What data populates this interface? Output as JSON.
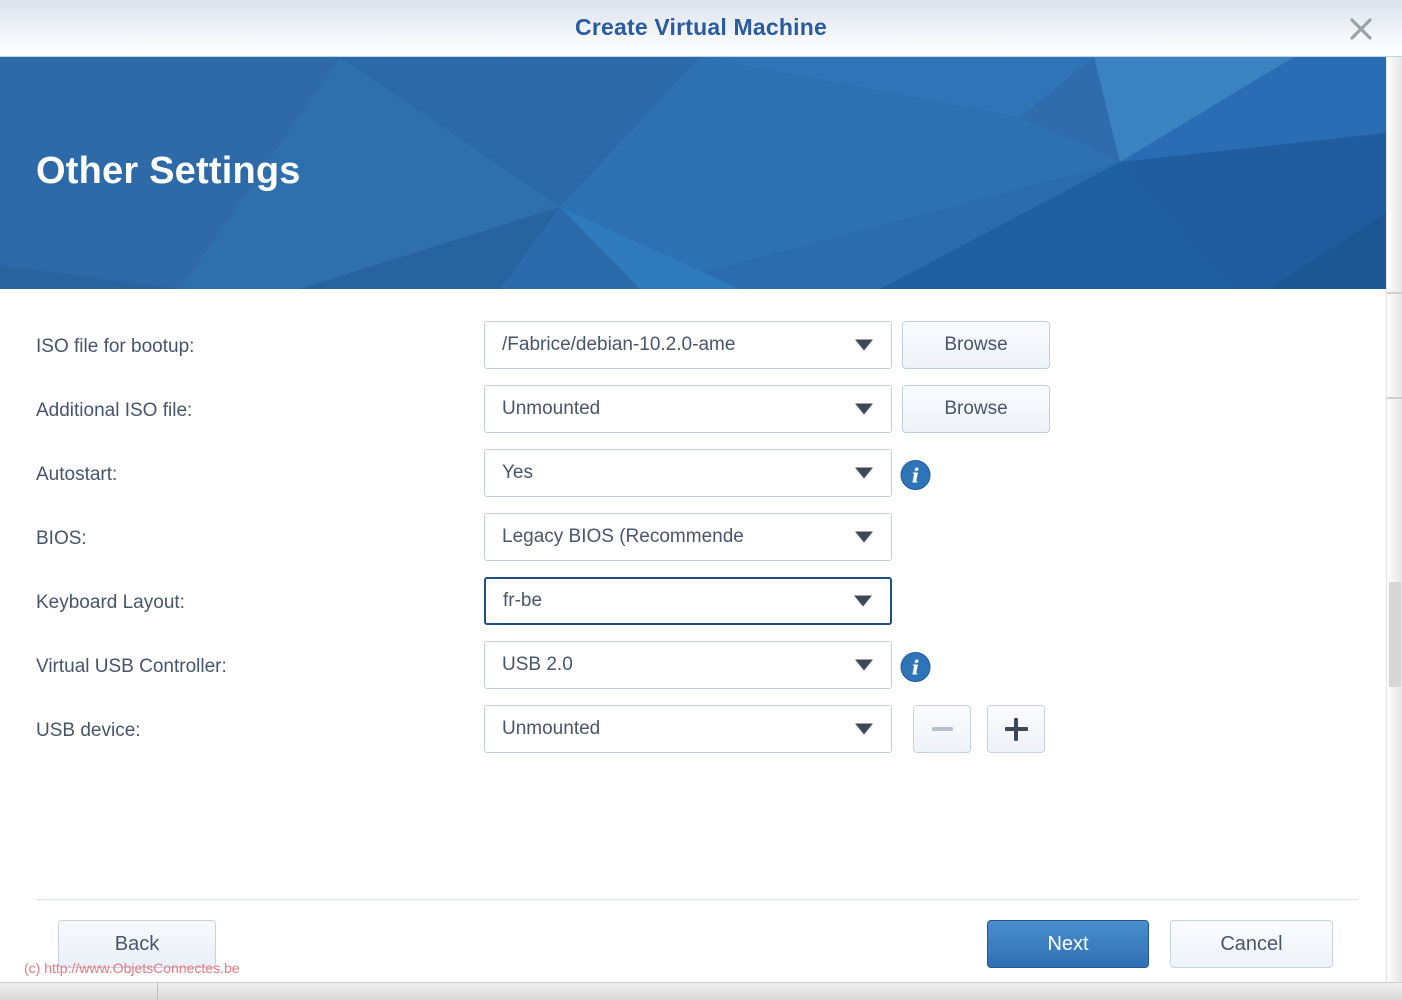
{
  "window": {
    "title": "Create Virtual Machine",
    "close_icon": "close-icon"
  },
  "banner": {
    "heading": "Other Settings",
    "accent_color": "#2e6cab"
  },
  "form": {
    "rows": [
      {
        "label": "ISO file for bootup:",
        "value": "/Fabrice/debian-10.2.0-amе",
        "control": "select",
        "action": "Browse",
        "name": "iso-file-for-bootup",
        "focused": false,
        "info": false
      },
      {
        "label": "Additional ISO file:",
        "value": "Unmounted",
        "control": "select",
        "action": "Browse",
        "name": "additional-iso-file",
        "focused": false,
        "info": false
      },
      {
        "label": "Autostart:",
        "value": "Yes",
        "control": "select",
        "name": "autostart",
        "focused": false,
        "info": true
      },
      {
        "label": "BIOS:",
        "value": "Legacy BIOS (Recommendе",
        "control": "select",
        "name": "bios",
        "focused": false,
        "info": false
      },
      {
        "label": "Keyboard Layout:",
        "value": "fr-be",
        "control": "select",
        "name": "keyboard-layout",
        "focused": true,
        "info": false
      },
      {
        "label": "Virtual USB Controller:",
        "value": "USB 2.0",
        "control": "select",
        "name": "virtual-usb-controller",
        "focused": false,
        "info": true
      },
      {
        "label": "USB device:",
        "value": "Unmounted",
        "control": "select",
        "name": "usb-device",
        "focused": false,
        "info": false,
        "stepper": true
      }
    ]
  },
  "footer": {
    "back_label": "Back",
    "next_label": "Next",
    "cancel_label": "Cancel",
    "next_color": "#2f6fb2"
  },
  "watermark": {
    "text": "(c) http://www.ObjetsConnectes.be",
    "color": "#e8777e"
  }
}
